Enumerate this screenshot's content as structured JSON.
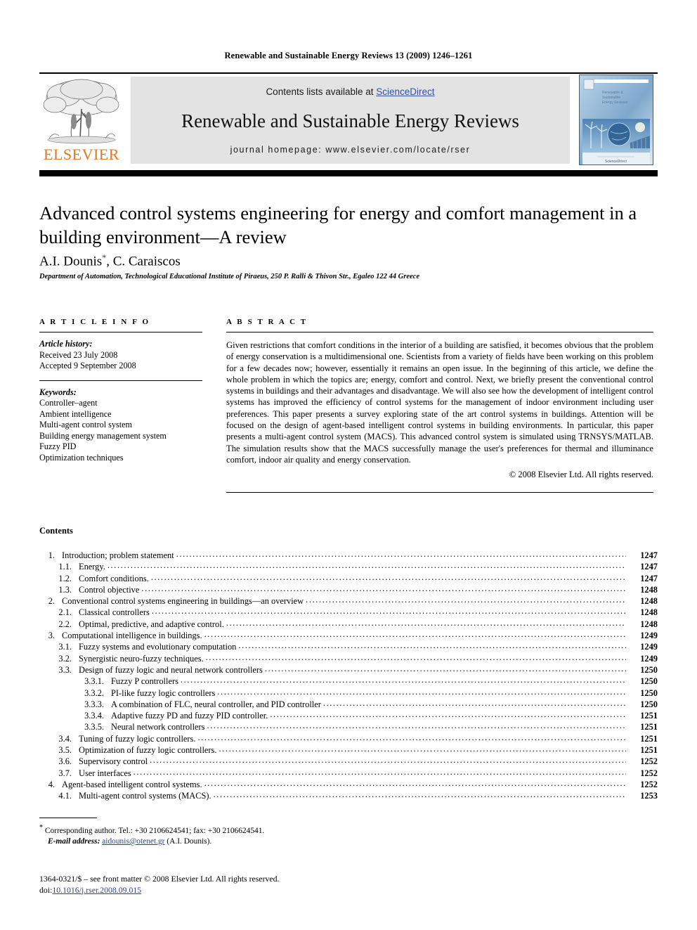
{
  "running_head": "Renewable and Sustainable Energy Reviews 13 (2009) 1246–1261",
  "masthead": {
    "publisher": "ELSEVIER",
    "contents_prefix": "Contents lists available at ",
    "sciencedirect": "ScienceDirect",
    "journal_title": "Renewable and Sustainable Energy Reviews",
    "homepage": "journal homepage: www.elsevier.com/locate/rser",
    "cover_title": "Renewable & Sustainable Energy Reviews",
    "cover_footer": "ScienceDirect",
    "sciencedirect_color": "#2d51a3",
    "elsevier_color": "#E8761B"
  },
  "article": {
    "title": "Advanced control systems engineering for energy and comfort management in a building environment—A review",
    "authors": "A.I. Dounis",
    "author_marker": "*",
    "authors_rest": ", C. Caraiscos",
    "affiliation": "Department of Automation, Technological Educational Institute of Piraeus, 250 P. Ralli & Thivon Str., Egaleo 122 44 Greece"
  },
  "info": {
    "heading": "A R T I C L E   I N F O",
    "history_label": "Article history:",
    "received": "Received 23 July 2008",
    "accepted": "Accepted 9 September 2008",
    "keywords_label": "Keywords:",
    "keywords": [
      "Controller–agent",
      "Ambient intelligence",
      "Multi-agent control system",
      "Building energy management system",
      "Fuzzy PID",
      "Optimization techniques"
    ]
  },
  "abstract": {
    "heading": "A B S T R A C T",
    "text": "Given restrictions that comfort conditions in the interior of a building are satisfied, it becomes obvious that the problem of energy conservation is a multidimensional one. Scientists from a variety of fields have been working on this problem for a few decades now; however, essentially it remains an open issue. In the beginning of this article, we define the whole problem in which the topics are; energy, comfort and control. Next, we briefly present the conventional control systems in buildings and their advantages and disadvantage. We will also see how the development of intelligent control systems has improved the efficiency of control systems for the management of indoor environment including user preferences. This paper presents a survey exploring state of the art control systems in buildings. Attention will be focused on the design of agent-based intelligent control systems in building environments. In particular, this paper presents a multi-agent control system (MACS). This advanced control system is simulated using TRNSYS/MATLAB. The simulation results show that the MACS successfully manage the user's preferences for thermal and illuminance comfort, indoor air quality and energy conservation.",
    "copyright": "© 2008 Elsevier Ltd. All rights reserved."
  },
  "contents": {
    "heading": "Contents",
    "entries": [
      {
        "level": 1,
        "num": "1.",
        "label": "Introduction; problem statement",
        "page": "1247"
      },
      {
        "level": 2,
        "num": "1.1.",
        "label": "Energy.",
        "page": "1247"
      },
      {
        "level": 2,
        "num": "1.2.",
        "label": "Comfort conditions.",
        "page": "1247"
      },
      {
        "level": 2,
        "num": "1.3.",
        "label": "Control objective",
        "page": "1248"
      },
      {
        "level": 1,
        "num": "2.",
        "label": "Conventional control systems engineering in buildings—an overview",
        "page": "1248"
      },
      {
        "level": 2,
        "num": "2.1.",
        "label": "Classical controllers",
        "page": "1248"
      },
      {
        "level": 2,
        "num": "2.2.",
        "label": "Optimal, predictive, and adaptive control.",
        "page": "1248"
      },
      {
        "level": 1,
        "num": "3.",
        "label": "Computational intelligence in buildings.",
        "page": "1249"
      },
      {
        "level": 2,
        "num": "3.1.",
        "label": "Fuzzy systems and evolutionary computation",
        "page": "1249"
      },
      {
        "level": 2,
        "num": "3.2.",
        "label": "Synergistic neuro-fuzzy techniques.",
        "page": "1249"
      },
      {
        "level": 2,
        "num": "3.3.",
        "label": "Design of fuzzy logic and neural network controllers",
        "page": "1250"
      },
      {
        "level": 3,
        "num": "3.3.1.",
        "label": "Fuzzy P controllers",
        "page": "1250"
      },
      {
        "level": 3,
        "num": "3.3.2.",
        "label": "PI-like fuzzy logic controllers",
        "page": "1250"
      },
      {
        "level": 3,
        "num": "3.3.3.",
        "label": "A combination of FLC, neural controller, and PID controller",
        "page": "1250"
      },
      {
        "level": 3,
        "num": "3.3.4.",
        "label": "Adaptive fuzzy PD and fuzzy PID controller.",
        "page": "1251"
      },
      {
        "level": 3,
        "num": "3.3.5.",
        "label": "Neural network controllers",
        "page": "1251"
      },
      {
        "level": 2,
        "num": "3.4.",
        "label": "Tuning of fuzzy logic controllers.",
        "page": "1251"
      },
      {
        "level": 2,
        "num": "3.5.",
        "label": "Optimization of fuzzy logic controllers.",
        "page": "1251"
      },
      {
        "level": 2,
        "num": "3.6.",
        "label": "Supervisory control",
        "page": "1252"
      },
      {
        "level": 2,
        "num": "3.7.",
        "label": "User interfaces",
        "page": "1252"
      },
      {
        "level": 1,
        "num": "4.",
        "label": "Agent-based intelligent control systems.",
        "page": "1252"
      },
      {
        "level": 2,
        "num": "4.1.",
        "label": "Multi-agent control systems (MACS).",
        "page": "1253"
      }
    ]
  },
  "footnotes": {
    "corresponding_marker": "*",
    "corresponding": "Corresponding author. Tel.: +30 2106624541; fax: +30 2106624541.",
    "email_label": "E-mail address:",
    "email": "aidounis@otenet.gr",
    "email_suffix": "(A.I. Dounis)."
  },
  "footer": {
    "front_matter": "1364-0321/$ – see front matter © 2008 Elsevier Ltd. All rights reserved.",
    "doi_label": "doi:",
    "doi": "10.1016/j.rser.2008.09.015"
  }
}
